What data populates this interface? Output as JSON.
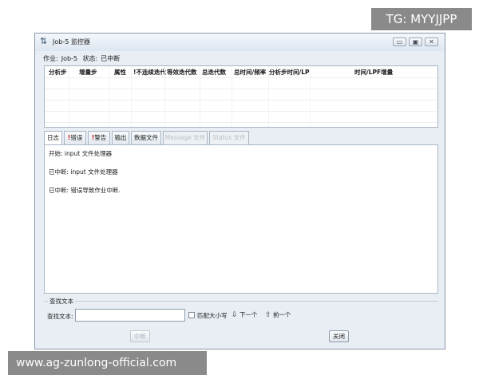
{
  "watermarks": {
    "top": "TG: MYYJJPP",
    "bottom": "www.ag-zunlong-official.com"
  },
  "window": {
    "title": "Job-5 监控器",
    "controls": {
      "minimize": "▭",
      "maximize": "▣",
      "close": "✕"
    }
  },
  "job": {
    "job_label": "作业:",
    "job_name": "Job-5",
    "status_label": "状态:",
    "status_value": "已中断"
  },
  "table": {
    "columns": [
      "分析步",
      "增量步",
      "属性",
      "!不连续迭代",
      "等效迭代数",
      "总迭代数",
      "总时间/频率",
      "分析步时间/LP",
      "时间/LPF增量"
    ],
    "rows": []
  },
  "tabs": [
    {
      "label": "日志",
      "warn": ""
    },
    {
      "label": "错误",
      "warn": "!"
    },
    {
      "label": "警告",
      "warn": "!"
    },
    {
      "label": "输出",
      "warn": ""
    },
    {
      "label": "数据文件",
      "warn": ""
    },
    {
      "label": "Message 文件",
      "warn": ""
    },
    {
      "label": "Status 文件",
      "warn": ""
    }
  ],
  "log": [
    "开始:  input 文件处理器",
    "已中断:  input 文件处理器",
    "已中断:  错误导致作业中断."
  ],
  "find": {
    "legend": "查找文本",
    "label": "查找文本:",
    "value": "",
    "match_case": "匹配大小写",
    "next": "下一个",
    "prev": "前一个"
  },
  "buttons": {
    "abort": "中断",
    "close": "关闭"
  }
}
